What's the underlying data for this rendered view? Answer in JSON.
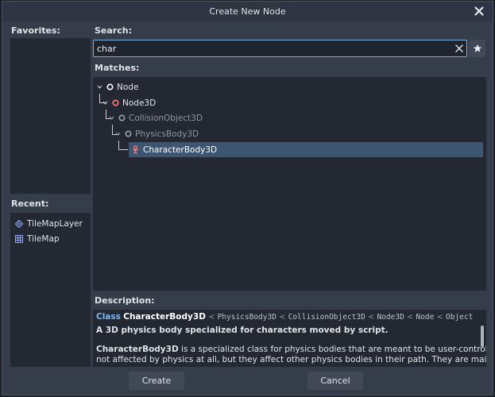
{
  "window": {
    "title": "Create New Node"
  },
  "favorites": {
    "label": "Favorites:"
  },
  "recent": {
    "label": "Recent:",
    "items": [
      {
        "label": "TileMapLayer",
        "icon": "tilemaplayer-icon"
      },
      {
        "label": "TileMap",
        "icon": "tilemap-icon"
      }
    ]
  },
  "search": {
    "label": "Search:",
    "value": "char"
  },
  "matches": {
    "label": "Matches:",
    "items": [
      {
        "label": "Node",
        "icon": "node-icon",
        "expanded": true
      },
      {
        "label": "Node3D",
        "icon": "node3d-icon",
        "expanded": true
      },
      {
        "label": "CollisionObject3D",
        "icon": "node-icon",
        "expanded": true
      },
      {
        "label": "PhysicsBody3D",
        "icon": "node-icon",
        "expanded": true
      },
      {
        "label": "CharacterBody3D",
        "icon": "characterbody3d-icon",
        "selected": true
      }
    ]
  },
  "description": {
    "label": "Description:",
    "class_keyword": "Class",
    "class_name": "CharacterBody3D",
    "inheritance": [
      "PhysicsBody3D",
      "CollisionObject3D",
      "Node3D",
      "Node",
      "Object"
    ],
    "separator": "<",
    "brief": "A 3D physics body specialized for characters moved by script.",
    "body_name": "CharacterBody3D",
    "body_line1": " is a specialized class for physics bodies that are meant to be user-controlled. They are",
    "body_line2": "not affected by physics at all, but they affect other physics bodies in their path. They are mainly used to"
  },
  "buttons": {
    "create": "Create",
    "cancel": "Cancel"
  },
  "colors": {
    "accent": "#7fb1dc",
    "selection": "#3c5571",
    "node3d_red": "#fc7f7f",
    "character_red": "#fc7f7f",
    "tilemap_blue": "#8da5f3"
  }
}
